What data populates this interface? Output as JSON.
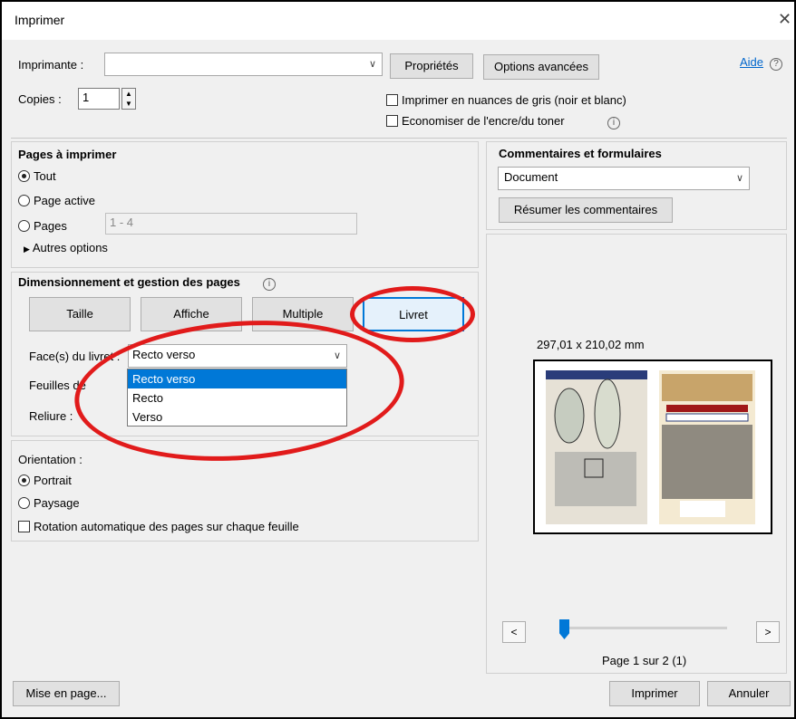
{
  "window": {
    "title": "Imprimer",
    "close_glyph": "✕"
  },
  "printer": {
    "label": "Imprimante :",
    "value": "",
    "properties_btn": "Propriétés",
    "advanced_btn": "Options avancées",
    "help_link": "Aide"
  },
  "copies": {
    "label": "Copies :",
    "value": "1"
  },
  "options": {
    "grayscale": "Imprimer en nuances de gris (noir et blanc)",
    "save_ink": "Economiser de l'encre/du toner"
  },
  "pages": {
    "title": "Pages à imprimer",
    "all": "Tout",
    "current": "Page active",
    "range_label": "Pages",
    "range_placeholder": "1 - 4",
    "more": "Autres options"
  },
  "sizing": {
    "title": "Dimensionnement et gestion des pages",
    "btn_size": "Taille",
    "btn_poster": "Affiche",
    "btn_multiple": "Multiple",
    "btn_booklet": "Livret",
    "sides_label": "Face(s) du livret :",
    "sides_value": "Recto verso",
    "sheets_label": "Feuilles de",
    "binding_label": "Reliure :",
    "dropdown_options": [
      "Recto verso",
      "Recto",
      "Verso"
    ]
  },
  "orientation": {
    "title": "Orientation :",
    "portrait": "Portrait",
    "landscape": "Paysage",
    "auto_rotate": "Rotation automatique des pages sur chaque feuille"
  },
  "comments": {
    "title": "Commentaires et formulaires",
    "value": "Document",
    "summarize_btn": "Résumer les commentaires"
  },
  "preview": {
    "dimensions": "297,01 x 210,02 mm",
    "page_info": "Page 1 sur 2 (1)",
    "prev": "<",
    "next": ">"
  },
  "footer": {
    "page_setup": "Mise en page...",
    "print": "Imprimer",
    "cancel": "Annuler"
  },
  "colors": {
    "accent": "#0078d7",
    "annotation": "#e11b1b"
  }
}
